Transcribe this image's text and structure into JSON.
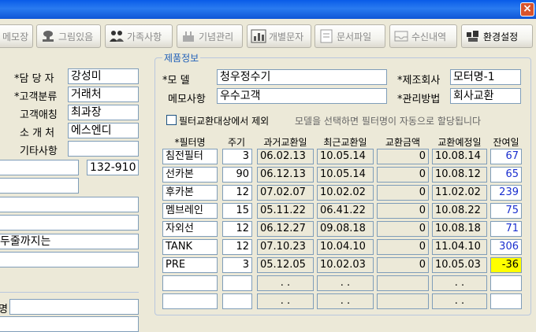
{
  "window": {
    "close_label": "×"
  },
  "toolbar": {
    "buttons": [
      {
        "id": "memo",
        "label": "메모장"
      },
      {
        "id": "image",
        "label": "그림있음"
      },
      {
        "id": "family",
        "label": "가족사항"
      },
      {
        "id": "anniversary",
        "label": "기념관리"
      },
      {
        "id": "sms",
        "label": "개별문자"
      },
      {
        "id": "document",
        "label": "문서파일"
      },
      {
        "id": "received",
        "label": "수신내역"
      },
      {
        "id": "settings",
        "label": "환경설정"
      }
    ]
  },
  "customer": {
    "manager_label": "*담 당 자",
    "manager_value": "강성미",
    "category_label": "*고객분류",
    "category_value": "거래처",
    "nickname_label": "고객애칭",
    "nickname_value": "최과장",
    "referrer_label": "소 개 처",
    "referrer_value": "에스엔디",
    "other_label": "기타사항",
    "other_value": "",
    "postal_value": "132-910",
    "note_value": "두줄까지는",
    "bottom_label": "명"
  },
  "product": {
    "section_title": "제품정보",
    "model_label": "*모   델",
    "model_value": "청우정수기",
    "maker_label": "*제조회사",
    "maker_value": "모터명-1",
    "memo_label": "메모사항",
    "memo_value": "우수고객",
    "method_label": "*관리방법",
    "method_value": "회사교환",
    "exclude_label": "필터교환대상에서 제외",
    "hint_text": "모델을 선택하면 필터명이 자동으로 할당됩니다"
  },
  "filters": {
    "headers": [
      "*필터명",
      "주기",
      "과거교환일",
      "최근교환일",
      "교환금액",
      "교환예정일",
      "잔여일"
    ],
    "rows": [
      {
        "name": "침전필터",
        "cycle": "3",
        "past": "06.02.13",
        "recent": "10.05.14",
        "amount": "0",
        "planned": "10.08.14",
        "remain": "67"
      },
      {
        "name": "선카본",
        "cycle": "90",
        "past": "06.12.13",
        "recent": "10.05.14",
        "amount": "0",
        "planned": "10.08.12",
        "remain": "65"
      },
      {
        "name": "후카본",
        "cycle": "12",
        "past": "07.02.07",
        "recent": "10.02.02",
        "amount": "0",
        "planned": "11.02.02",
        "remain": "239"
      },
      {
        "name": "멤브레인",
        "cycle": "15",
        "past": "05.11.22",
        "recent": "06.41.22",
        "amount": "0",
        "planned": "10.08.22",
        "remain": "75"
      },
      {
        "name": "자외선",
        "cycle": "12",
        "past": "06.12.27",
        "recent": "09.08.18",
        "amount": "0",
        "planned": "10.08.18",
        "remain": "71"
      },
      {
        "name": "TANK",
        "cycle": "12",
        "past": "07.10.23",
        "recent": "10.04.10",
        "amount": "0",
        "planned": "11.04.10",
        "remain": "306"
      },
      {
        "name": "PRE",
        "cycle": "3",
        "past": "05.12.05",
        "recent": "10.02.03",
        "amount": "0",
        "planned": "10.05.03",
        "remain": "-36"
      },
      {
        "name": "",
        "cycle": "",
        "past": ".  .",
        "recent": ".  .",
        "amount": "",
        "planned": ".  .",
        "remain": ""
      },
      {
        "name": "",
        "cycle": "",
        "past": ".  .",
        "recent": ".  .",
        "amount": "",
        "planned": ".  .",
        "remain": ""
      }
    ]
  },
  "colors": {
    "remain_blue": "#1a2ecf",
    "overdue": "#ffff00",
    "title_blue": "#0a5ce8"
  }
}
